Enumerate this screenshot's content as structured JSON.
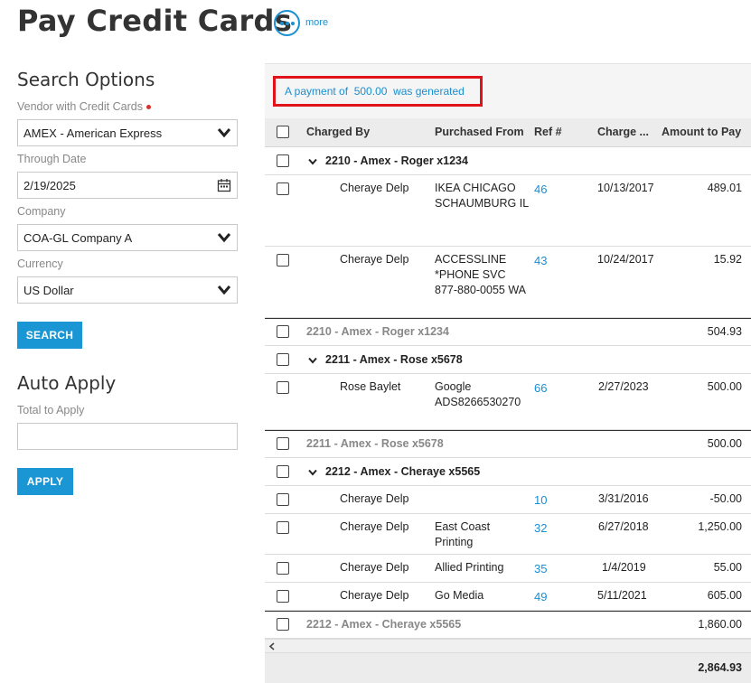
{
  "page": {
    "title": "Pay Credit Cards",
    "more_label": "more"
  },
  "search": {
    "title": "Search Options",
    "vendor_label": "Vendor with Credit Cards",
    "vendor_value": "AMEX - American Express",
    "through_date_label": "Through Date",
    "through_date_value": "2/19/2025",
    "company_label": "Company",
    "company_value": "COA-GL Company A",
    "currency_label": "Currency",
    "currency_value": "US Dollar",
    "search_button": "SEARCH"
  },
  "auto_apply": {
    "title": "Auto Apply",
    "total_label": "Total to Apply",
    "total_value": "",
    "apply_button": "APPLY"
  },
  "notice": {
    "text": "A payment of  500.00  was generated"
  },
  "grid": {
    "columns": {
      "charged_by": "Charged By",
      "purchased_from": "Purchased From",
      "ref": "Ref #",
      "charge_date": "Charge ...",
      "amount": "Amount to Pay"
    },
    "group1": {
      "header": "2210 - Amex - Roger x1234",
      "rows": [
        {
          "charged_by": "Cheraye Delp",
          "purchased_from_1": "IKEA CHICAGO",
          "purchased_from_2": "SCHAUMBURG IL",
          "purchased_from_3": "",
          "ref": "46",
          "date": "10/13/2017",
          "amount": "489.01"
        },
        {
          "charged_by": "Cheraye Delp",
          "purchased_from_1": "ACCESSLINE",
          "purchased_from_2": "*PHONE SVC",
          "purchased_from_3": "877-880-0055 WA",
          "ref": "43",
          "date": "10/24/2017",
          "amount": "15.92"
        }
      ],
      "subtotal_label": "2210 - Amex - Roger x1234",
      "subtotal": "504.93"
    },
    "group2": {
      "header": "2211 - Amex - Rose x5678",
      "rows": [
        {
          "charged_by": "Rose Baylet",
          "purchased_from_1": "Google",
          "purchased_from_2": "ADS8266530270",
          "ref": "66",
          "date": "2/27/2023",
          "amount": "500.00"
        }
      ],
      "subtotal_label": "2211 - Amex - Rose x5678",
      "subtotal": "500.00"
    },
    "group3": {
      "header": "2212 - Amex - Cheraye x5565",
      "rows": [
        {
          "charged_by": "Cheraye Delp",
          "purchased_from_1": "",
          "purchased_from_2": "",
          "ref": "10",
          "date": "3/31/2016",
          "amount": "-50.00"
        },
        {
          "charged_by": "Cheraye Delp",
          "purchased_from_1": "East Coast",
          "purchased_from_2": "Printing",
          "ref": "32",
          "date": "6/27/2018",
          "amount": "1,250.00"
        },
        {
          "charged_by": "Cheraye Delp",
          "purchased_from_1": "Allied Printing",
          "purchased_from_2": "",
          "ref": "35",
          "date": "1/4/2019",
          "amount": "55.00"
        },
        {
          "charged_by": "Cheraye Delp",
          "purchased_from_1": "Go Media",
          "purchased_from_2": "",
          "ref": "49",
          "date": "5/11/2021",
          "amount": "605.00"
        }
      ],
      "subtotal_label": "2212 - Amex - Cheraye x5565",
      "subtotal": "1,860.00"
    },
    "grand_total": "2,864.93"
  },
  "colors": {
    "accent": "#1a96d4",
    "link": "#1a8fd1",
    "notice_border": "#e0131a",
    "required": "#d9302c"
  }
}
